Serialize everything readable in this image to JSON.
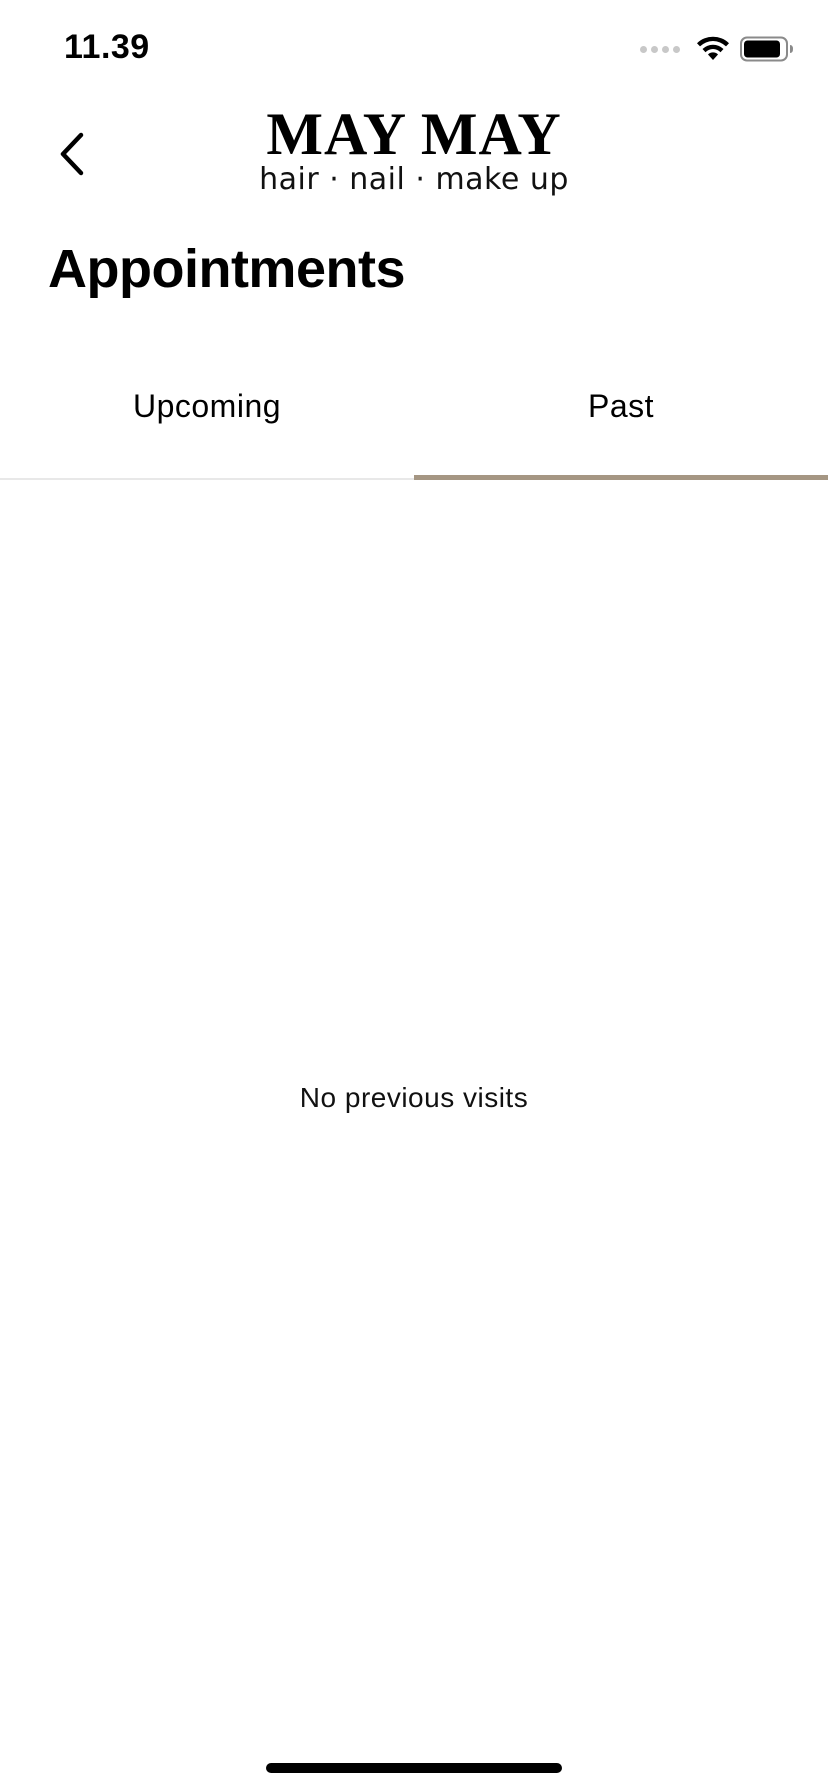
{
  "status_bar": {
    "time": "11.39",
    "signal_icon": "cellular-dots-icon",
    "wifi_icon": "wifi-icon",
    "battery_icon": "battery-icon"
  },
  "header": {
    "back_icon": "chevron-left-icon",
    "logo_main": "MAY MAY",
    "logo_sub": "hair · nail · make up"
  },
  "page": {
    "title": "Appointments"
  },
  "tabs": [
    {
      "label": "Upcoming",
      "active": false
    },
    {
      "label": "Past",
      "active": true
    }
  ],
  "empty_state": {
    "message": "No previous visits"
  },
  "colors": {
    "accent": "#a59683",
    "divider": "#e8e8e8",
    "text": "#000000"
  }
}
